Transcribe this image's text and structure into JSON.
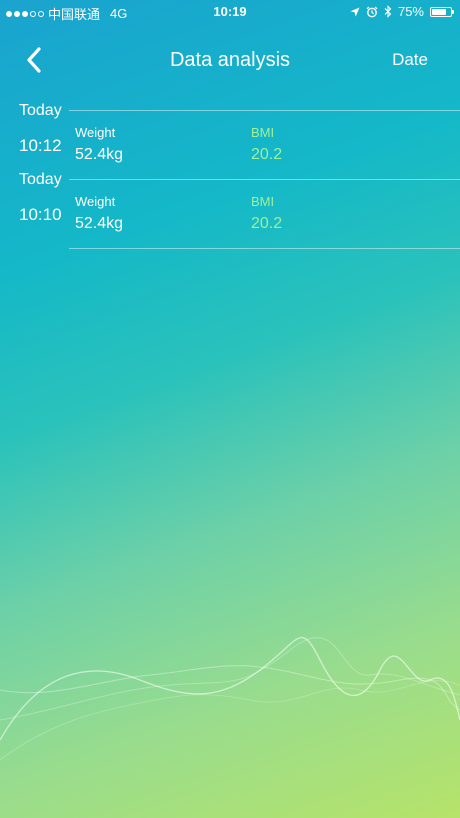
{
  "status_bar": {
    "carrier": "中国联通",
    "network": "4G",
    "time": "10:19",
    "battery_percent": "75%",
    "battery_level": 0.75,
    "signal_bars_filled": 3,
    "signal_bars_total": 5
  },
  "nav": {
    "title": "Data analysis",
    "right_action": "Date",
    "back_icon": "chevron-left-icon"
  },
  "records": [
    {
      "date": "Today",
      "time": "10:12",
      "weight_label": "Weight",
      "weight_value": "52.4kg",
      "bmi_label": "BMI",
      "bmi_value": "20.2"
    },
    {
      "date": "Today",
      "time": "10:10",
      "weight_label": "Weight",
      "weight_value": "52.4kg",
      "bmi_label": "BMI",
      "bmi_value": "20.2"
    }
  ],
  "colors": {
    "bmi_accent": "#9ef09a",
    "text": "#ffffff",
    "gradient_top": "#1aa3cf",
    "gradient_bottom": "#b6e36a"
  }
}
